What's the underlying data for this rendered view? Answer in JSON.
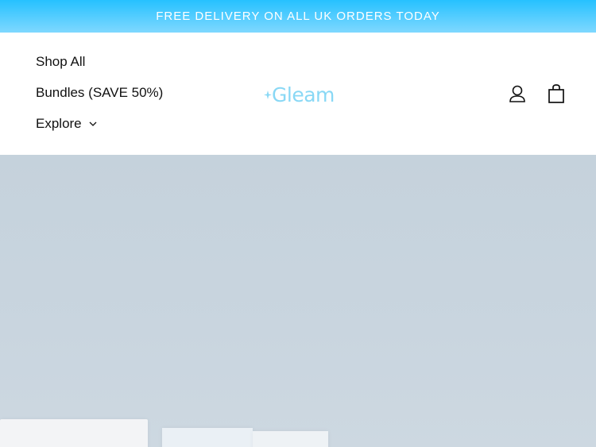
{
  "announcement": {
    "text": "FREE DELIVERY ON ALL UK ORDERS TODAY"
  },
  "nav": {
    "items": [
      {
        "label": "Shop All"
      },
      {
        "label": "Bundles (SAVE 50%)"
      },
      {
        "label": "Explore"
      }
    ]
  },
  "logo": {
    "text": "Gleam",
    "icon": "sparkle-icon",
    "color": "#89d8f5"
  },
  "header_icons": {
    "account": "user-icon",
    "cart": "shopping-bag-icon"
  },
  "colors": {
    "announcement_bg": "#26c1ff",
    "hero_bg": "#c8d4de"
  }
}
